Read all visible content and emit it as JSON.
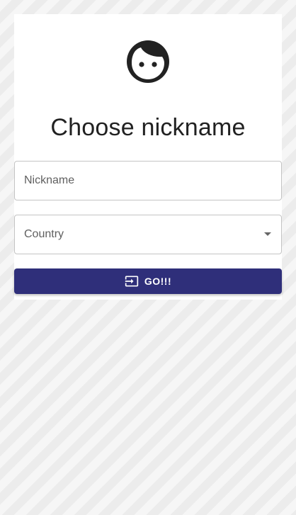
{
  "form": {
    "avatar_icon": "face-icon",
    "title": "Choose nickname",
    "nickname_placeholder": "Nickname",
    "country_placeholder": "Country",
    "submit_label": "GO!!!",
    "submit_icon": "input-icon",
    "accent_color": "#2f2f7a"
  }
}
